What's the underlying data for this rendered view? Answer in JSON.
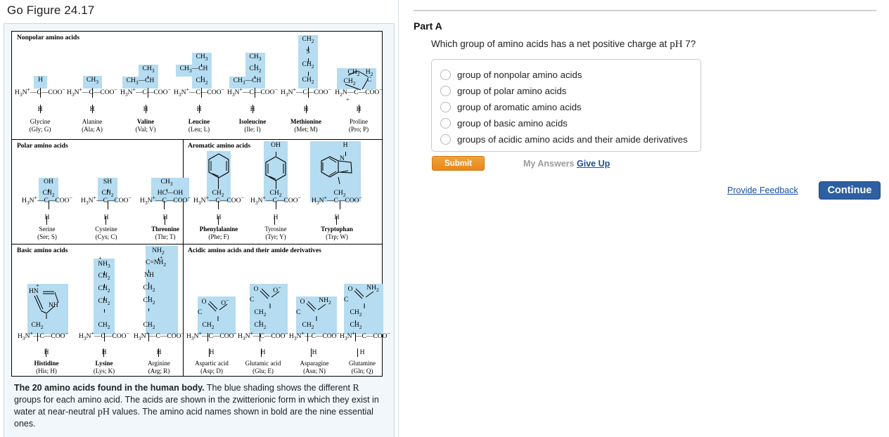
{
  "figure": {
    "title": "Go Figure 24.17",
    "caption_bold": "The 20 amino acids found in the human body.",
    "caption_rest_1": " The blue shading shows the different ",
    "caption_R": "R",
    "caption_rest_2": " groups for each amino acid. The acids are shown in the zwitterionic form in which they exist in water at near-neutral ",
    "caption_pH": "pH",
    "caption_rest_3": " values. The amino acid names shown in bold are the nine essential ones.",
    "sections": {
      "nonpolar": "Nonpolar amino acids",
      "polar": "Polar amino acids",
      "aromatic": "Aromatic amino acids",
      "basic": "Basic amino acids",
      "acidic": "Acidic amino acids and their amide derivatives"
    },
    "shade_color": "#b5dcf0",
    "amino_acids": [
      {
        "name": "Glycine",
        "code": "(Gly; G)",
        "essential": false,
        "group": "nonpolar",
        "r_group": "H"
      },
      {
        "name": "Alanine",
        "code": "(Ala; A)",
        "essential": false,
        "group": "nonpolar",
        "r_group": "CH3"
      },
      {
        "name": "Valine",
        "code": "(Val; V)",
        "essential": true,
        "group": "nonpolar",
        "r_group": "CH3-CH-CH3"
      },
      {
        "name": "Leucine",
        "code": "(Leu; L)",
        "essential": true,
        "group": "nonpolar",
        "r_group": "CH2-CH(CH3)-CH3"
      },
      {
        "name": "Isoleucine",
        "code": "(Ile; I)",
        "essential": true,
        "group": "nonpolar",
        "r_group": "CH3-CH-CH2-CH3"
      },
      {
        "name": "Methionine",
        "code": "(Met; M)",
        "essential": true,
        "group": "nonpolar",
        "r_group": "CH2-CH2-S-CH3"
      },
      {
        "name": "Proline",
        "code": "(Pro; P)",
        "essential": false,
        "group": "nonpolar",
        "r_group": "pyrrolidine ring"
      },
      {
        "name": "Serine",
        "code": "(Ser; S)",
        "essential": false,
        "group": "polar",
        "r_group": "CH2-OH"
      },
      {
        "name": "Cysteine",
        "code": "(Cys; C)",
        "essential": false,
        "group": "polar",
        "r_group": "CH2-SH"
      },
      {
        "name": "Threonine",
        "code": "(Thr; T)",
        "essential": true,
        "group": "polar",
        "r_group": "HC(CH3)-OH"
      },
      {
        "name": "Phenylalanine",
        "code": "(Phe; F)",
        "essential": true,
        "group": "aromatic",
        "r_group": "CH2-phenyl"
      },
      {
        "name": "Tyrosine",
        "code": "(Tyr; Y)",
        "essential": false,
        "group": "aromatic",
        "r_group": "CH2-phenol"
      },
      {
        "name": "Tryptophan",
        "code": "(Trp; W)",
        "essential": true,
        "group": "aromatic",
        "r_group": "CH2-indole"
      },
      {
        "name": "Histidine",
        "code": "(His; H)",
        "essential": true,
        "group": "basic",
        "r_group": "CH2-imidazolium"
      },
      {
        "name": "Lysine",
        "code": "(Lys; K)",
        "essential": true,
        "group": "basic",
        "r_group": "(CH2)4-NH3+"
      },
      {
        "name": "Arginine",
        "code": "(Arg; R)",
        "essential": false,
        "group": "basic",
        "r_group": "(CH2)3-NH-C(NH2)=NH2+"
      },
      {
        "name": "Aspartic acid",
        "code": "(Asp; D)",
        "essential": false,
        "group": "acidic",
        "r_group": "CH2-COO-"
      },
      {
        "name": "Glutamic acid",
        "code": "(Glu; E)",
        "essential": false,
        "group": "acidic",
        "r_group": "(CH2)2-COO-"
      },
      {
        "name": "Asparagine",
        "code": "(Asn; N)",
        "essential": false,
        "group": "acidic",
        "r_group": "CH2-CONH2"
      },
      {
        "name": "Glutamine",
        "code": "(Gln; Q)",
        "essential": false,
        "group": "acidic",
        "r_group": "(CH2)2-CONH2"
      }
    ]
  },
  "question": {
    "part_label": "Part A",
    "text_before": "Which group of amino acids has a net positive charge at ",
    "ph": "pH",
    "text_after": " 7?",
    "choices": [
      "group of nonpolar amino acids",
      "group of polar amino acids",
      "group of aromatic amino acids",
      "group of basic amino acids",
      "groups of acidic amino acids and their amide derivatives"
    ],
    "selected": null
  },
  "actions": {
    "submit": "Submit",
    "my_answers": "My Answers",
    "give_up": "Give Up",
    "provide_feedback": "Provide Feedback",
    "continue": "Continue"
  },
  "colors": {
    "submit_orange": "#e8881b",
    "continue_blue": "#2e5fa3",
    "link_blue": "#1a4ea0",
    "panel_bg": "#f2f7fc",
    "shade_blue": "#b5dcf0"
  }
}
